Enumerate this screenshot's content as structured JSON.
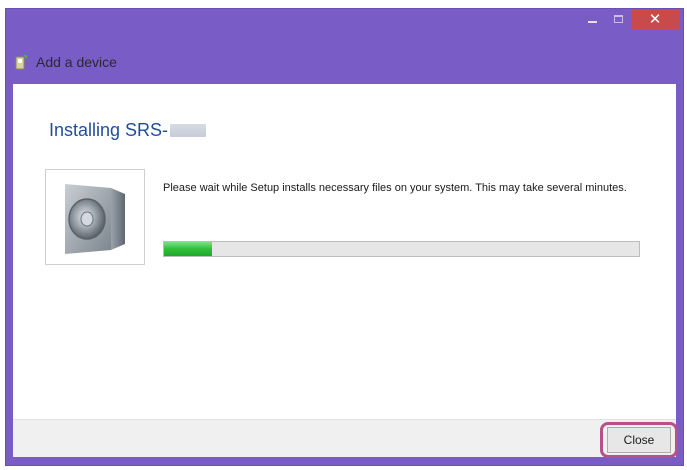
{
  "window": {
    "title": "Add a device",
    "accent_color": "#7a5cc7",
    "close_glyph": "✕"
  },
  "install": {
    "heading": "Installing SRS-",
    "message": "Please wait while Setup installs necessary files on your system. This may take several minutes.",
    "progress_fraction": 0.1,
    "device_icon": "speaker-icon"
  },
  "footer": {
    "close_label": "Close",
    "highlight_color": "#b4508a"
  }
}
